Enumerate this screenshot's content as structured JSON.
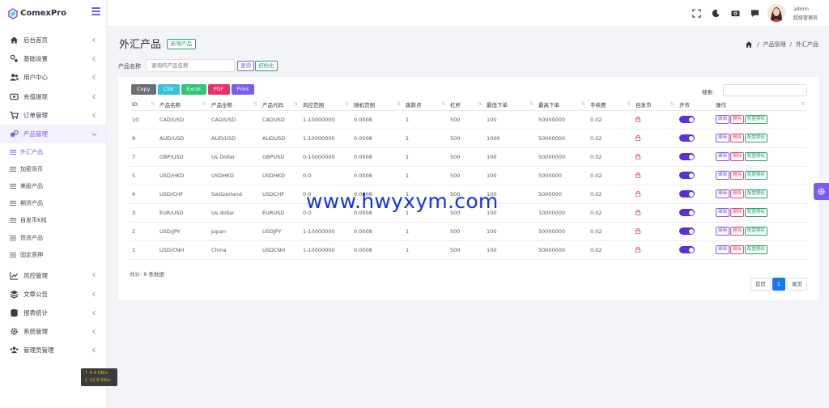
{
  "brand": {
    "name": "ComexPro"
  },
  "sidebar": {
    "items": [
      {
        "label": "后台首页",
        "icon": "home-icon"
      },
      {
        "label": "基础设置",
        "icon": "settings-basic-icon"
      },
      {
        "label": "用户中心",
        "icon": "users-icon"
      },
      {
        "label": "充值提现",
        "icon": "wallet-icon"
      },
      {
        "label": "订单管理",
        "icon": "cart-icon"
      },
      {
        "label": "产品管理",
        "icon": "product-icon"
      }
    ],
    "subitems": [
      {
        "label": "外汇产品"
      },
      {
        "label": "加密货币"
      },
      {
        "label": "美股产品"
      },
      {
        "label": "期货产品"
      },
      {
        "label": "自发币K线"
      },
      {
        "label": "债货产品"
      },
      {
        "label": "固定质押"
      }
    ],
    "items_after": [
      {
        "label": "风控管理",
        "icon": "chart-line-icon"
      },
      {
        "label": "文章公告",
        "icon": "layers-icon"
      },
      {
        "label": "报表统计",
        "icon": "database-icon"
      },
      {
        "label": "系统管理",
        "icon": "gear-icon"
      },
      {
        "label": "管理员管理",
        "icon": "admins-icon"
      }
    ],
    "speed": {
      "up": "↑ 0.6 KB/s",
      "down": "↓ 12.8 KB/s"
    }
  },
  "header": {
    "user_name": "admin",
    "user_role": "超级管理员",
    "icons": [
      "fullscreen-icon",
      "moon-icon",
      "camera-icon",
      "message-icon"
    ]
  },
  "page": {
    "title": "外汇产品",
    "add_label": "新增产品",
    "breadcrumb": [
      "产品管理",
      "外汇产品"
    ],
    "breadcrumb_sep": "/"
  },
  "search": {
    "label": "产品名称",
    "placeholder": "查询的产品名称",
    "query_label": "查询",
    "reset_label": "初始化"
  },
  "export_buttons": [
    {
      "label": "Copy",
      "color": "#6c6f73"
    },
    {
      "label": "CSV",
      "color": "#3cc0d6"
    },
    {
      "label": "Excel",
      "color": "#31c47a"
    },
    {
      "label": "PDF",
      "color": "#e8306d"
    },
    {
      "label": "Print",
      "color": "#7b5cf0"
    }
  ],
  "table": {
    "search_label": "搜索:",
    "columns": [
      "ID",
      "产品名称",
      "产品全称",
      "产品代码",
      "风控范围",
      "随机范围",
      "跳跌点",
      "杠杆",
      "最低下单",
      "最高下单",
      "手续费",
      "自发币",
      "开市",
      "操作"
    ],
    "rows": [
      [
        "10",
        "CAD/USD",
        "CAD/USD",
        "CADUSD",
        "1-10000000",
        "0.0008",
        "1",
        "500",
        "100",
        "50000000",
        "0.02"
      ],
      [
        "9",
        "AUD/USD",
        "AUD/USD",
        "AUDUSD",
        "1-10000000",
        "0.0008",
        "1",
        "500",
        "1000",
        "50000000",
        "0.02"
      ],
      [
        "7",
        "GBP/USD",
        "Us Dollar",
        "GBPUSD",
        "0-10000000",
        "0.0008",
        "1",
        "500",
        "100",
        "50000000",
        "0.02"
      ],
      [
        "5",
        "USD/HKD",
        "USDHKD",
        "USDHKD",
        "0-0",
        "0.0008",
        "1",
        "500",
        "100",
        "5000000",
        "0.02"
      ],
      [
        "4",
        "USD/CHF",
        "Switzerland",
        "USDCHF",
        "0-0",
        "0.0008",
        "1",
        "500",
        "100",
        "5000000",
        "0.02"
      ],
      [
        "3",
        "EUR/USD",
        "Us dollar",
        "EURUSD",
        "0-0",
        "0.0008",
        "1",
        "500",
        "100",
        "10000000",
        "0.02"
      ],
      [
        "2",
        "USD/JPY",
        "Japan",
        "USDJPY",
        "1-10000000",
        "0.0008",
        "1",
        "500",
        "100",
        "50000000",
        "0.02"
      ],
      [
        "1",
        "USD/CNH",
        "China",
        "USDCNH",
        "1-10000000",
        "0.0008",
        "1",
        "500",
        "100",
        "50000000",
        "0.02"
      ]
    ],
    "op_labels": {
      "edit": "编辑",
      "delete": "删除",
      "config": "配置期权"
    },
    "total_text": "共计: 8 条数据"
  },
  "pagination": {
    "first": "首页",
    "current": "1",
    "last": "尾页"
  },
  "watermark": "www.hwyxym.com",
  "colors": {
    "accent": "#7b5cf0",
    "toggle": "#5b30d6",
    "success": "#28a36b",
    "danger": "#e24a6c",
    "pager_active": "#1877f2"
  }
}
